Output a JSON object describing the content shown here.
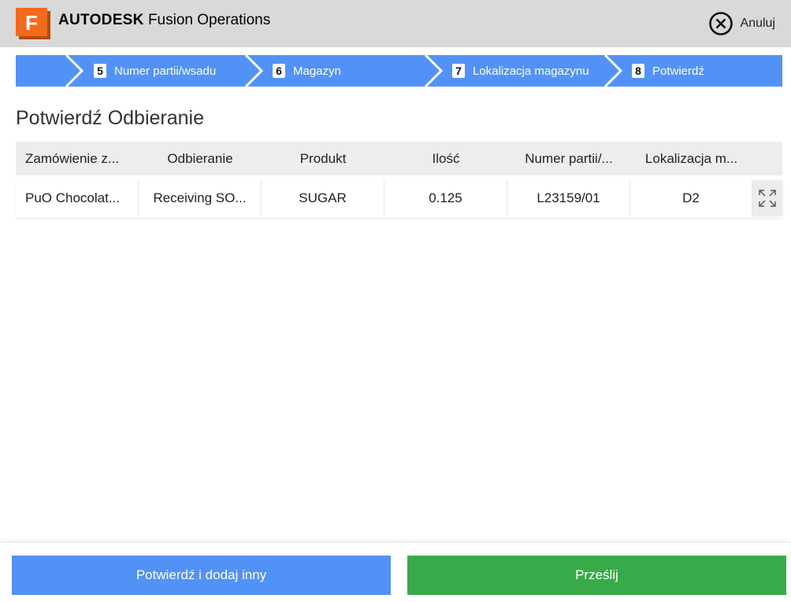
{
  "header": {
    "brand_bold": "AUTODESK",
    "brand_rest": "Fusion Operations",
    "logo_letter": "F",
    "cancel_label": "Anuluj"
  },
  "steps": [
    {
      "number": "5",
      "label": "Numer partii/wsadu"
    },
    {
      "number": "6",
      "label": "Magazyn"
    },
    {
      "number": "7",
      "label": "Lokalizacja magazynu"
    },
    {
      "number": "8",
      "label": "Potwierdź"
    }
  ],
  "page_title": "Potwierdź Odbieranie",
  "table": {
    "headers": [
      "Zamówienie z...",
      "Odbieranie",
      "Produkt",
      "Ilość",
      "Numer partii/...",
      "Lokalizacja m..."
    ],
    "rows": [
      [
        "PuO Chocolat...",
        "Receiving SO...",
        "SUGAR",
        "0.125",
        "L23159/01",
        "D2"
      ]
    ]
  },
  "footer": {
    "add_label": "Potwierdź i dodaj inny",
    "submit_label": "Prześlij"
  },
  "colors": {
    "accent_blue": "#5292f7",
    "submit_green": "#39aa49",
    "logo_orange": "#f26b1d"
  }
}
